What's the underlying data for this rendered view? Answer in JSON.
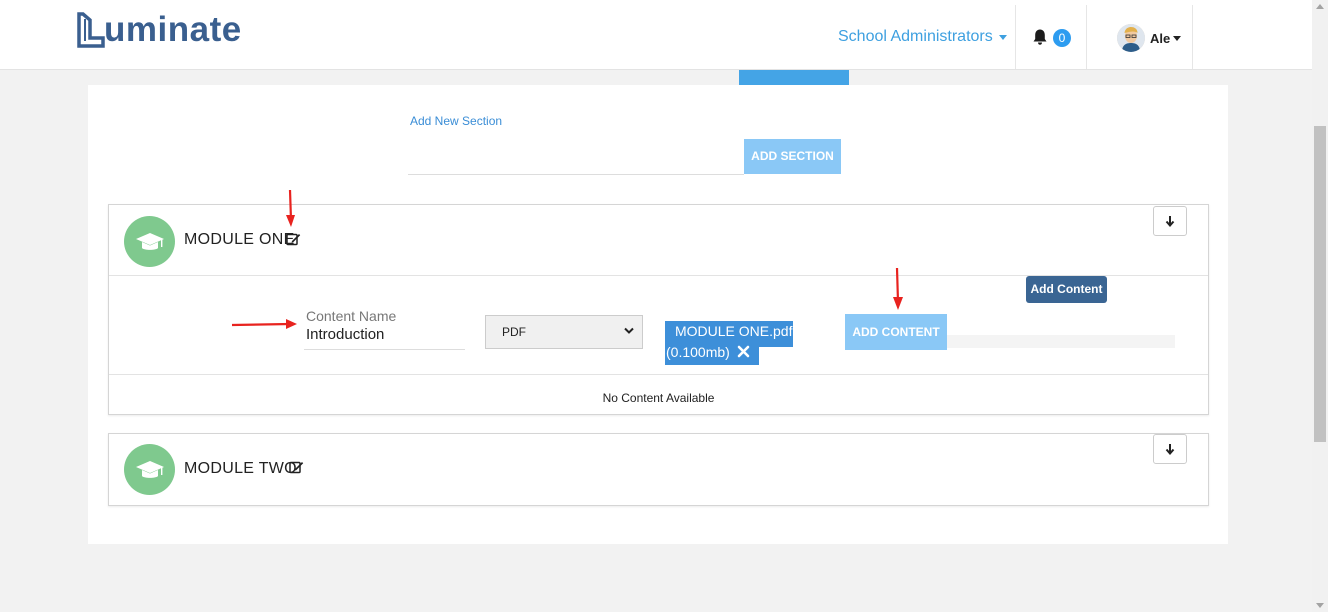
{
  "header": {
    "logo_text": "uminate",
    "role_menu": "School Administrators",
    "notifications_count": "0",
    "user_name": "Ale"
  },
  "section_form": {
    "label": "Add New Section",
    "input_value": "",
    "button_label": "ADD SECTION"
  },
  "modules": [
    {
      "title": "MODULE ONE",
      "content_form": {
        "name_label": "Content Name",
        "name_value": "Introduction",
        "type_selected": "PDF",
        "file_name": "MODULE ONE.pdf",
        "file_size": "(0.100mb)",
        "add_button_label": "ADD CONTENT",
        "tooltip": "Add Content"
      },
      "empty_message": "No Content Available"
    },
    {
      "title": "MODULE TWO"
    }
  ],
  "colors": {
    "brand": "#3a5f8f",
    "accent": "#3ea0e0",
    "button_light": "#8ac8f6",
    "module_icon": "#7fc98e",
    "annotation": "#e8231f"
  }
}
